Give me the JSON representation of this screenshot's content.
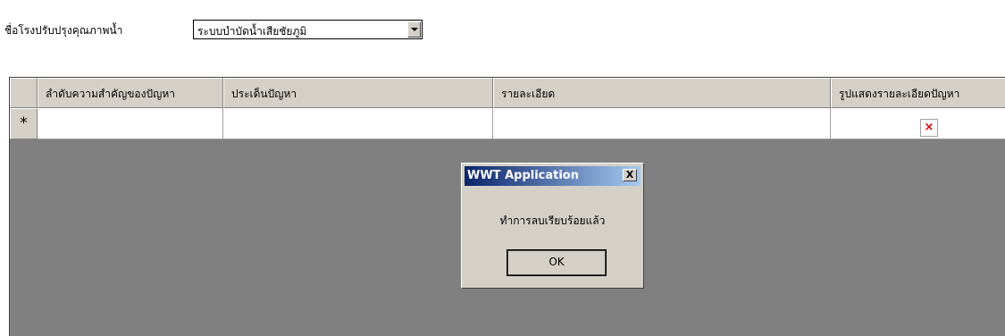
{
  "form": {
    "plant_label": "ชื่อโรงปรับปรุงคุณภาพน้ำ",
    "plant_value": "ระบบบำบัดน้ำเสียชัยภูมิ"
  },
  "grid": {
    "columns": [
      "ลำดับความสำคัญของปัญหา",
      "ประเด็นปัญหา",
      "รายละเอียด",
      "รูปแสดงรายละเอียดปัญหา"
    ],
    "new_row_marker": "*",
    "image_placeholder": "×"
  },
  "dialog": {
    "title": "WWT Application",
    "close_label": "X",
    "message": "ทำการลบเรียบร้อยแล้ว",
    "ok_label": "OK"
  }
}
